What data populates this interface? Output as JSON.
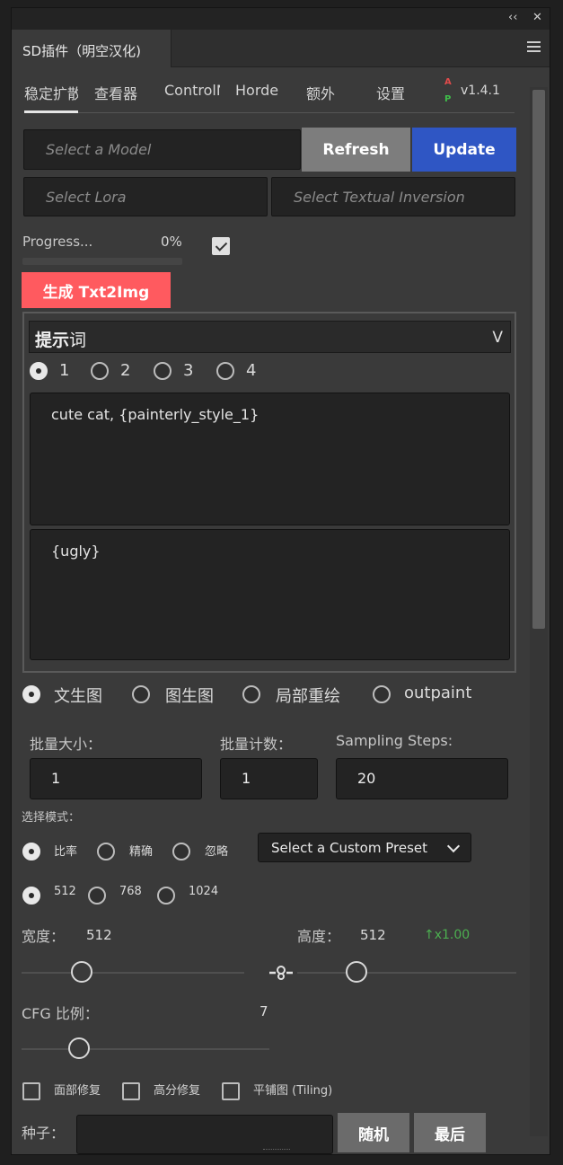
{
  "panel": {
    "collapse_glyph": "‹‹",
    "close_glyph": "✕",
    "title": "SD插件（明空汉化)"
  },
  "tabs": [
    {
      "label": "稳定扩散"
    },
    {
      "label": "查看器"
    },
    {
      "label": "ControlNet"
    },
    {
      "label": "Horde"
    },
    {
      "label": "额外"
    },
    {
      "label": "设置"
    }
  ],
  "logo": {
    "a": "A",
    "p": "P"
  },
  "version": "v1.4.1",
  "model": {
    "placeholder": "Select a Model"
  },
  "buttons": {
    "refresh": "Refresh",
    "update": "Update",
    "generate": "生成 Txt2Img",
    "random": "随机",
    "last": "最后"
  },
  "lora": {
    "placeholder": "Select Lora"
  },
  "textual_inversion": {
    "placeholder": "Select Textual Inversion"
  },
  "progress": {
    "label": "Progress...",
    "value": "0%",
    "fraction": 0
  },
  "prompt": {
    "title_bold": "提示",
    "title_rest": "词",
    "chevron": "V",
    "slots": [
      "1",
      "2",
      "3",
      "4"
    ],
    "selected_slot": "1",
    "positive": "cute cat, {painterly_style_1}",
    "negative": "{ugly}"
  },
  "modes": {
    "options": [
      "文生图",
      "图生图",
      "局部重绘",
      "outpaint"
    ],
    "selected": "文生图"
  },
  "batch": {
    "size_label": "批量大小：",
    "size_value": "1",
    "count_label": "批量计数：",
    "count_value": "1",
    "steps_label": "Sampling Steps:",
    "steps_value": "20"
  },
  "selection_mode": {
    "label": "选择模式：",
    "options": [
      "比率",
      "精确",
      "忽略"
    ],
    "selected": "比率"
  },
  "preset": {
    "label": "Select a Custom Preset"
  },
  "resolution": {
    "options": [
      "512",
      "768",
      "1024"
    ],
    "selected": "512"
  },
  "width": {
    "label": "宽度：",
    "value": "512"
  },
  "height": {
    "label": "高度：",
    "value": "512"
  },
  "ratio": "↑x1.00",
  "cfg": {
    "label": "CFG 比例：",
    "value": "7"
  },
  "options": {
    "face_restore": "面部修复",
    "hires_fix": "高分修复",
    "tiling": "平铺图 (Tiling)"
  },
  "seed": {
    "label": "种子：",
    "value": ""
  }
}
